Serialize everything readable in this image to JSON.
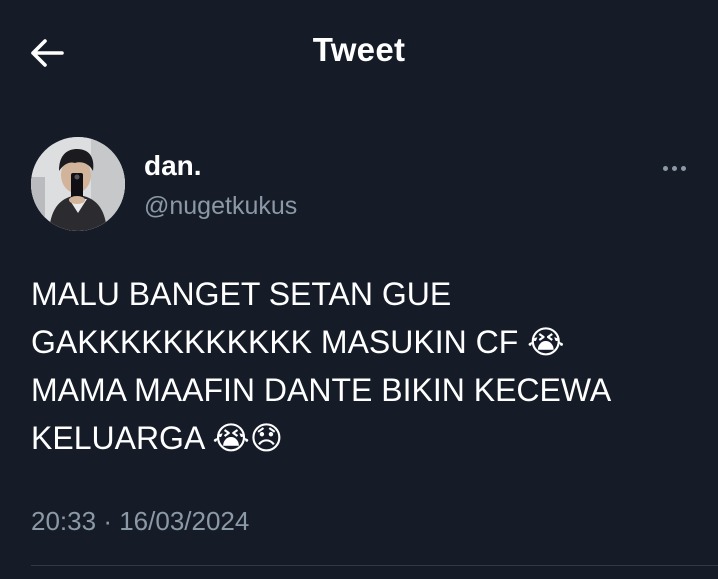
{
  "header": {
    "title": "Tweet",
    "back_icon": "arrow-left-icon"
  },
  "tweet": {
    "author": {
      "display_name": "dan.",
      "handle": "@nugetkukus"
    },
    "lines": [
      "MALU BANGET SETAN GUE",
      "GAKKKKKKKKKKK MASUKIN CF 😭",
      "MAMA MAAFIN DANTE BIKIN KECEWA",
      "KELUARGA 😭😞"
    ],
    "time": "20:33",
    "separator": "·",
    "date": "16/03/2024"
  },
  "colors": {
    "background": "#151c28",
    "text_primary": "#ffffff",
    "text_secondary": "#8b98a5",
    "divider": "#2f3a46"
  }
}
